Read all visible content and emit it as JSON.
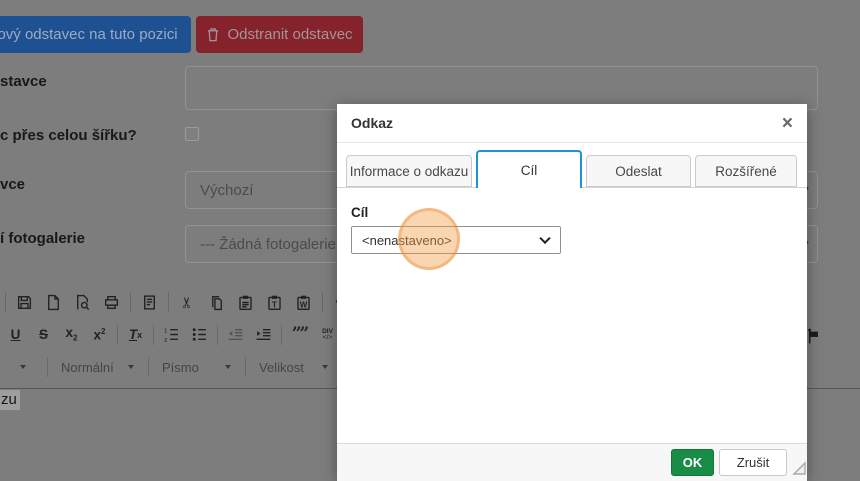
{
  "colors": {
    "overlay_background": "#7d7d7d",
    "insert_button_blue": "#1d5191",
    "delete_button_red": "#85222c",
    "active_tab_blue": "#1b93d6",
    "ok_button_green": "#198c45",
    "click_highlight_orange": "#f19b42"
  },
  "background": {
    "insert_button_label": "ový odstavec na tuto pozici",
    "delete_button_label": "Odstranit odstavec",
    "delete_button_icon": "trash-icon",
    "fields": [
      {
        "label": "stavce",
        "type": "text",
        "value": ""
      },
      {
        "label": "c přes celou šířku?",
        "type": "checkbox",
        "checked": false
      },
      {
        "label": "vce",
        "type": "select",
        "value": "Výchozí"
      },
      {
        "label": "í fotogalerie",
        "type": "select",
        "value": "--- Žádná fotogalerie"
      }
    ],
    "editor": {
      "toolbar_row1": [
        "separator",
        "save",
        "new-page",
        "preview",
        "print",
        "separator",
        "templates",
        "separator",
        "cut",
        "copy",
        "paste",
        "paste-text",
        "paste-word",
        "separator",
        "undo"
      ],
      "toolbar_row2": [
        "underline",
        "strikethrough",
        "subscript",
        "superscript",
        "separator",
        "remove-format",
        "separator",
        "numbered-list",
        "bulleted-list",
        "separator",
        "outdent-disabled",
        "indent",
        "separator",
        "blockquote",
        "div-container",
        "separator"
      ],
      "combos": [
        {
          "name": "styles",
          "label": ""
        },
        {
          "name": "format",
          "label": "Normální"
        },
        {
          "name": "font",
          "label": "Písmo"
        },
        {
          "name": "size",
          "label": "Velikost"
        }
      ],
      "anchor_icon": "flag-icon",
      "selected_text": "zu"
    }
  },
  "modal": {
    "title": "Odkaz",
    "close_label": "×",
    "tabs": [
      {
        "label": "Informace o odkazu",
        "active": false
      },
      {
        "label": "Cíl",
        "active": true
      },
      {
        "label": "Odeslat",
        "active": false
      },
      {
        "label": "Rozšířené",
        "active": false
      }
    ],
    "body": {
      "field_label": "Cíl",
      "select_value": "<nenastaveno>"
    },
    "footer": {
      "ok_label": "OK",
      "cancel_label": "Zrušit"
    }
  }
}
